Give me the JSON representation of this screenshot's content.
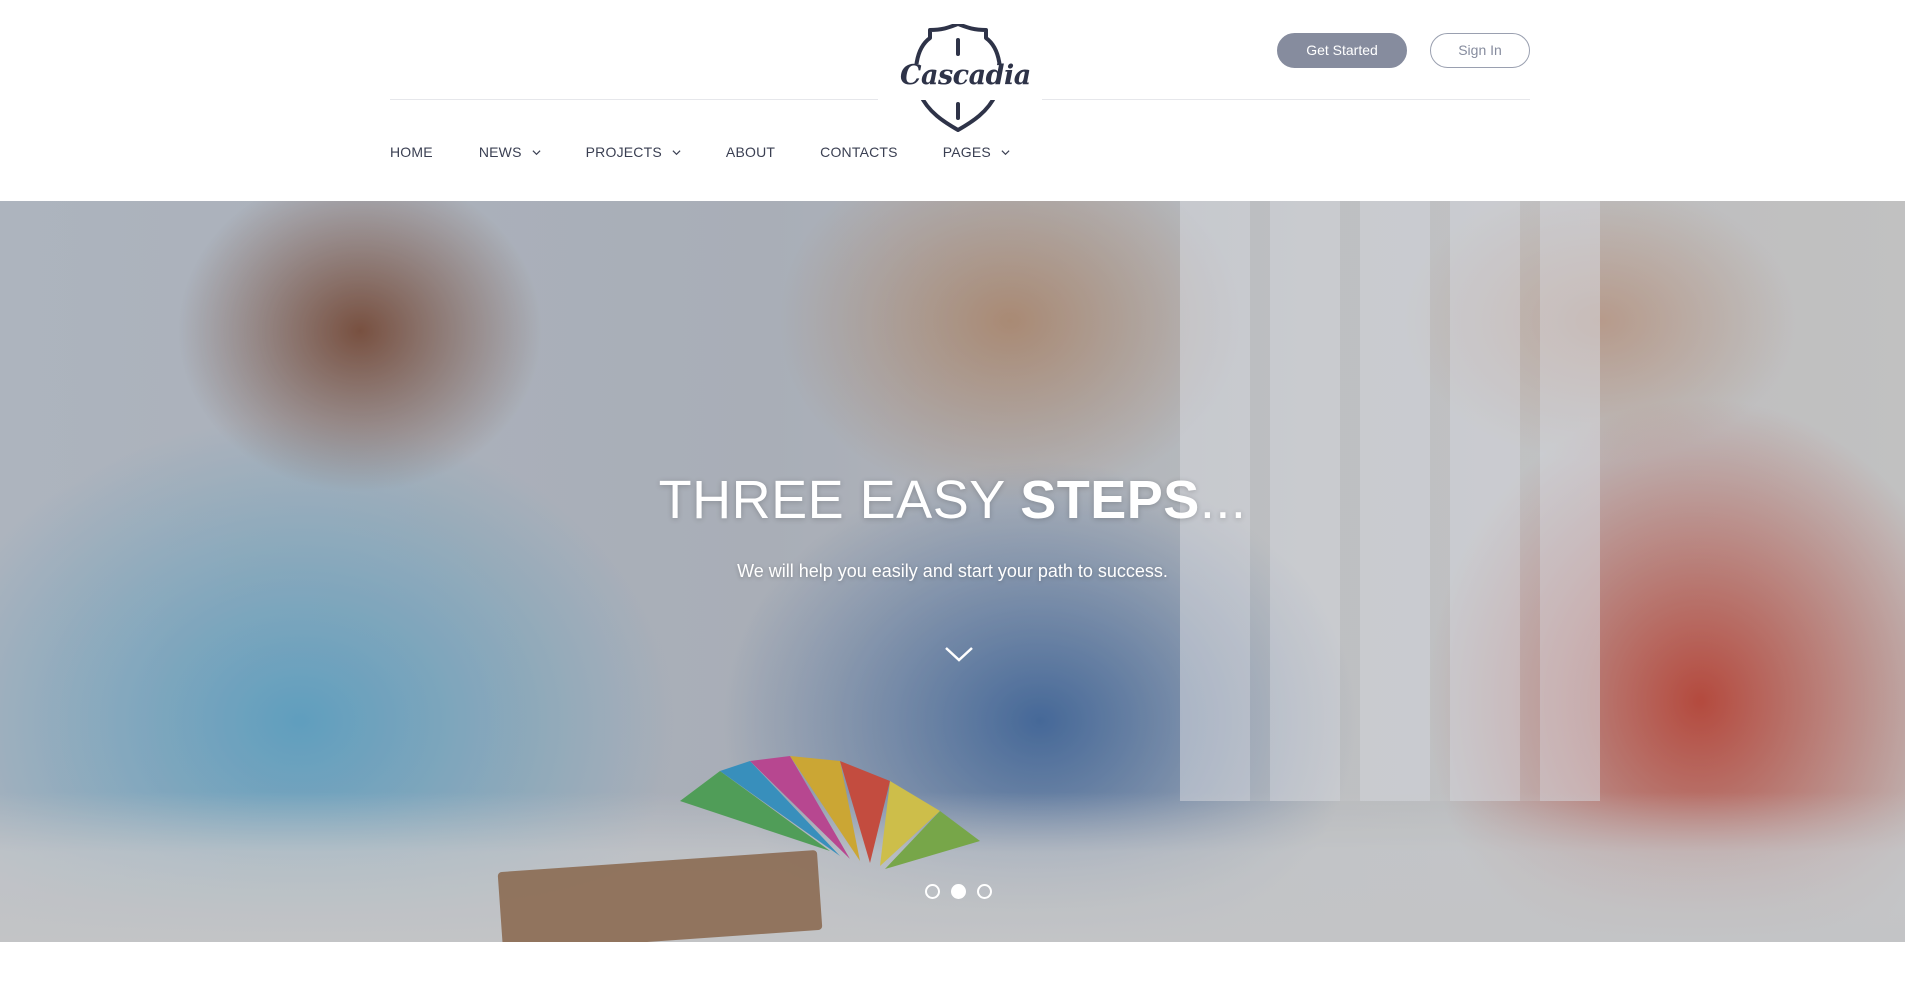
{
  "header": {
    "logo": {
      "text": "Cascadia",
      "icon": "shield-logo-icon"
    },
    "actions": {
      "get_started_label": "Get Started",
      "sign_in_label": "Sign In"
    },
    "nav": [
      {
        "label": "HOME",
        "has_dropdown": false
      },
      {
        "label": "NEWS",
        "has_dropdown": true
      },
      {
        "label": "PROJECTS",
        "has_dropdown": true
      },
      {
        "label": "ABOUT",
        "has_dropdown": false
      },
      {
        "label": "CONTACTS",
        "has_dropdown": false
      },
      {
        "label": "PAGES",
        "has_dropdown": true
      }
    ]
  },
  "hero": {
    "title_light": "THREE EASY ",
    "title_bold": "STEPS",
    "title_suffix": "...",
    "subtitle": "We will help you easily and start your path to success.",
    "scroll_icon": "chevron-down-icon",
    "slides": {
      "count": 3,
      "active_index": 1
    }
  },
  "colors": {
    "accent_button": "#868c9e",
    "text_dark": "#3a3f52",
    "rule": "#e6e7eb"
  }
}
